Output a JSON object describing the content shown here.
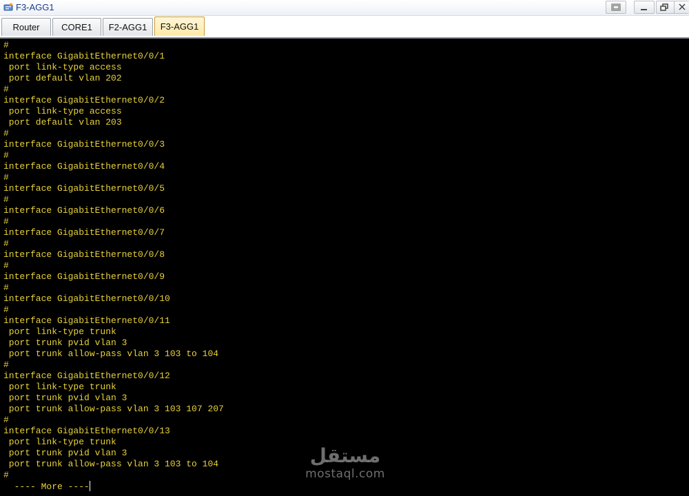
{
  "window": {
    "title": "F3-AGG1"
  },
  "tabs": [
    {
      "label": "Router"
    },
    {
      "label": "CORE1"
    },
    {
      "label": "F2-AGG1"
    },
    {
      "label": "F3-AGG1"
    }
  ],
  "active_tab": "F3-AGG1",
  "terminal": {
    "lines": [
      "#",
      "interface GigabitEthernet0/0/1",
      " port link-type access",
      " port default vlan 202",
      "#",
      "interface GigabitEthernet0/0/2",
      " port link-type access",
      " port default vlan 203",
      "#",
      "interface GigabitEthernet0/0/3",
      "#",
      "interface GigabitEthernet0/0/4",
      "#",
      "interface GigabitEthernet0/0/5",
      "#",
      "interface GigabitEthernet0/0/6",
      "#",
      "interface GigabitEthernet0/0/7",
      "#",
      "interface GigabitEthernet0/0/8",
      "#",
      "interface GigabitEthernet0/0/9",
      "#",
      "interface GigabitEthernet0/0/10",
      "#",
      "interface GigabitEthernet0/0/11",
      " port link-type trunk",
      " port trunk pvid vlan 3",
      " port trunk allow-pass vlan 3 103 to 104",
      "#",
      "interface GigabitEthernet0/0/12",
      " port link-type trunk",
      " port trunk pvid vlan 3",
      " port trunk allow-pass vlan 3 103 107 207",
      "#",
      "interface GigabitEthernet0/0/13",
      " port link-type trunk",
      " port trunk pvid vlan 3",
      " port trunk allow-pass vlan 3 103 to 104",
      "#"
    ],
    "more_prompt": "  ---- More ----"
  },
  "watermark": {
    "arabic": "مستقل",
    "latin": "mostaql.com"
  },
  "colors": {
    "terminal_bg": "#000000",
    "terminal_fg": "#e8d23a",
    "active_tab": "#ffe9a6",
    "title_text": "#1a3c8f"
  },
  "icons": {
    "app": "network-device-icon",
    "restore_all": "tile-windows-icon",
    "minimize": "minimize-icon",
    "maximize": "restore-icon",
    "close": "close-icon"
  }
}
